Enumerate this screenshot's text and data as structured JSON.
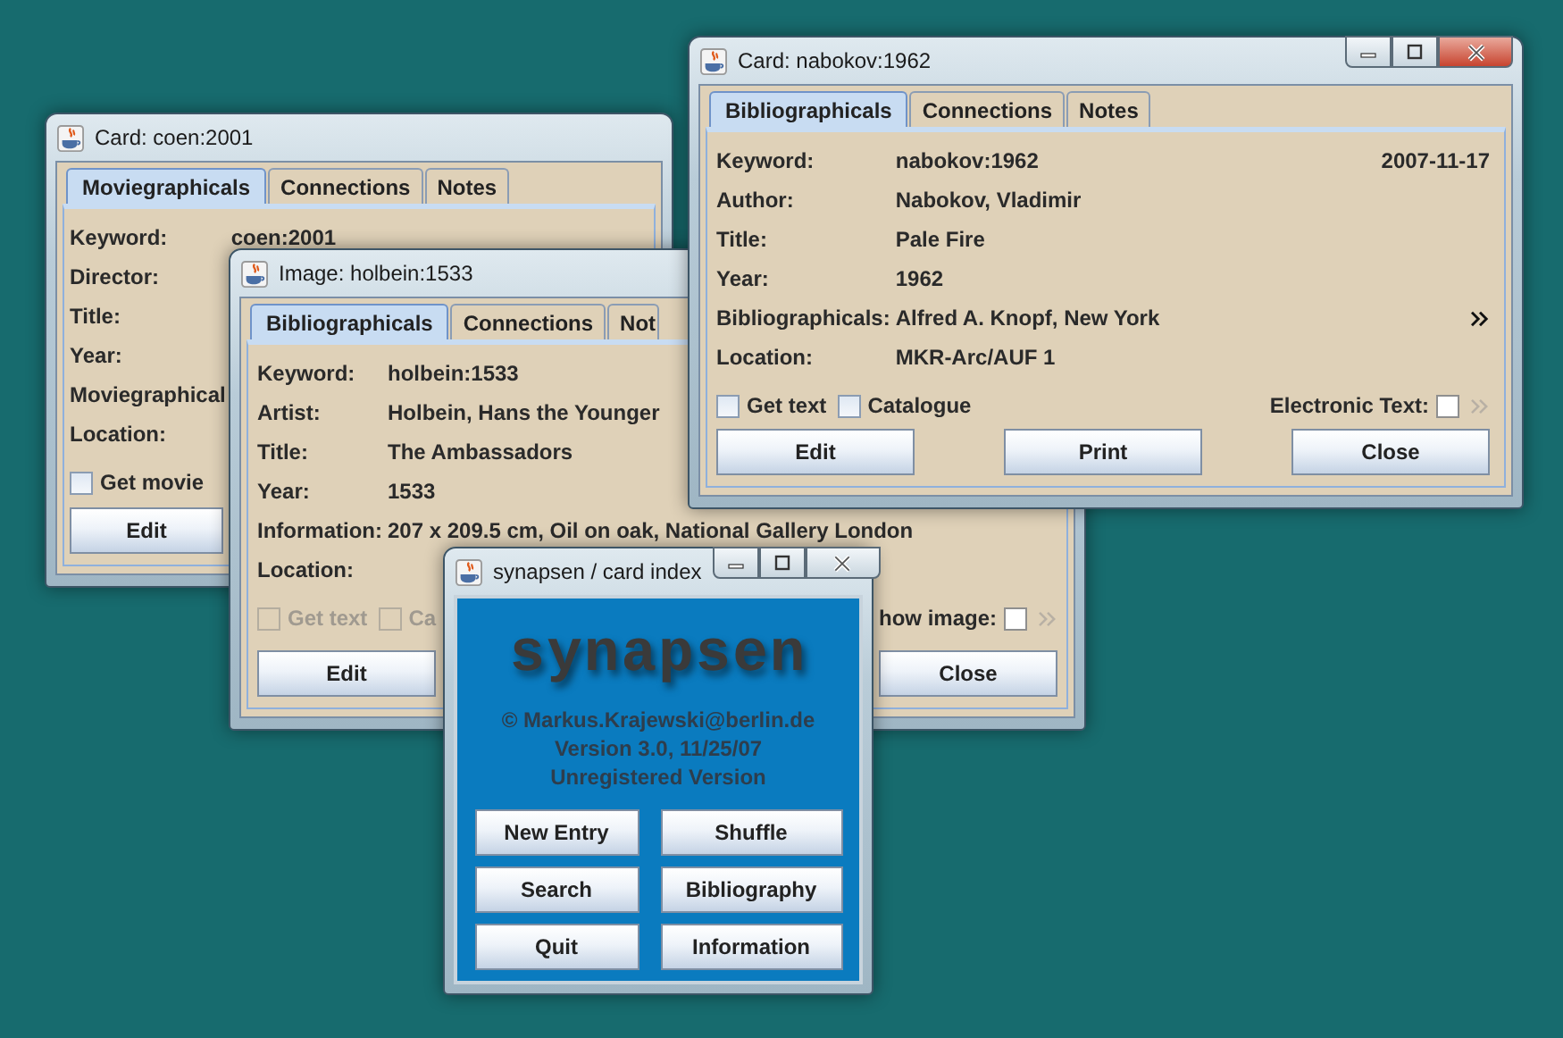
{
  "windows": [
    {
      "kind": "card",
      "title": "Card: coen:2001",
      "tabs": [
        {
          "label": "Moviegraphicals",
          "selected": true
        },
        {
          "label": "Connections",
          "selected": false
        },
        {
          "label": "Notes",
          "selected": false
        }
      ],
      "fields": [
        {
          "label": "Keyword:",
          "value": "coen:2001"
        },
        {
          "label": "Director:"
        },
        {
          "label": "Title:"
        },
        {
          "label": "Year:"
        },
        {
          "label": "Moviegraphical"
        },
        {
          "label": "Location:"
        }
      ],
      "checkboxes": [
        {
          "label": "Get movie",
          "checked": false,
          "disabled": false
        }
      ],
      "buttons": [
        "Edit"
      ]
    },
    {
      "kind": "card",
      "title": "Image: holbein:1533",
      "tabs": [
        {
          "label": "Bibliographicals",
          "selected": true
        },
        {
          "label": "Connections",
          "selected": false
        },
        {
          "label": "Not",
          "selected": false
        }
      ],
      "fields": [
        {
          "label": "Keyword:",
          "value": "holbein:1533"
        },
        {
          "label": "Artist:",
          "value": "Holbein, Hans the Younger"
        },
        {
          "label": "Title:",
          "value": "The Ambassadors"
        },
        {
          "label": "Year:",
          "value": "1533"
        },
        {
          "label": "Information:",
          "value": "207 x 209.5 cm, Oil on oak, National Gallery London"
        },
        {
          "label": "Location:"
        }
      ],
      "checkboxes": [
        {
          "label": "Get text",
          "checked": false,
          "disabled": true
        },
        {
          "label": "Ca",
          "checked": false,
          "disabled": true
        }
      ],
      "trailing": {
        "label": "how image:",
        "checked": false
      },
      "buttons": [
        "Edit",
        "Close"
      ]
    },
    {
      "kind": "card",
      "title": "Card: nabokov:1962",
      "controls": true,
      "tabs": [
        {
          "label": "Bibliographicals",
          "selected": true
        },
        {
          "label": "Connections",
          "selected": false
        },
        {
          "label": "Notes",
          "selected": false
        }
      ],
      "fields": [
        {
          "label": "Keyword:",
          "value": "nabokov:1962",
          "date": "2007-11-17"
        },
        {
          "label": "Author:",
          "value": "Nabokov, Vladimir"
        },
        {
          "label": "Title:",
          "value": "Pale Fire"
        },
        {
          "label": "Year:",
          "value": "1962"
        },
        {
          "label": "Bibliographicals:",
          "value": "Alfred A. Knopf, New York",
          "link": true
        },
        {
          "label": "Location:",
          "value": "MKR-Arc/AUF 1"
        }
      ],
      "checkboxes": [
        {
          "label": "Get text",
          "checked": false,
          "disabled": false
        },
        {
          "label": "Catalogue",
          "checked": false,
          "disabled": false
        }
      ],
      "trailing": {
        "label": "Electronic Text:",
        "checked": false
      },
      "buttons": [
        "Edit",
        "Print",
        "Close"
      ]
    },
    {
      "kind": "splash",
      "title": "synapsen / card index",
      "controls": true,
      "logo": "synapsen",
      "lines": [
        "© Markus.Krajewski@berlin.de",
        "Version 3.0, 11/25/07",
        "Unregistered Version"
      ],
      "buttons": [
        "New Entry",
        "Shuffle",
        "Search",
        "Bibliography",
        "Quit",
        "Information"
      ]
    }
  ]
}
